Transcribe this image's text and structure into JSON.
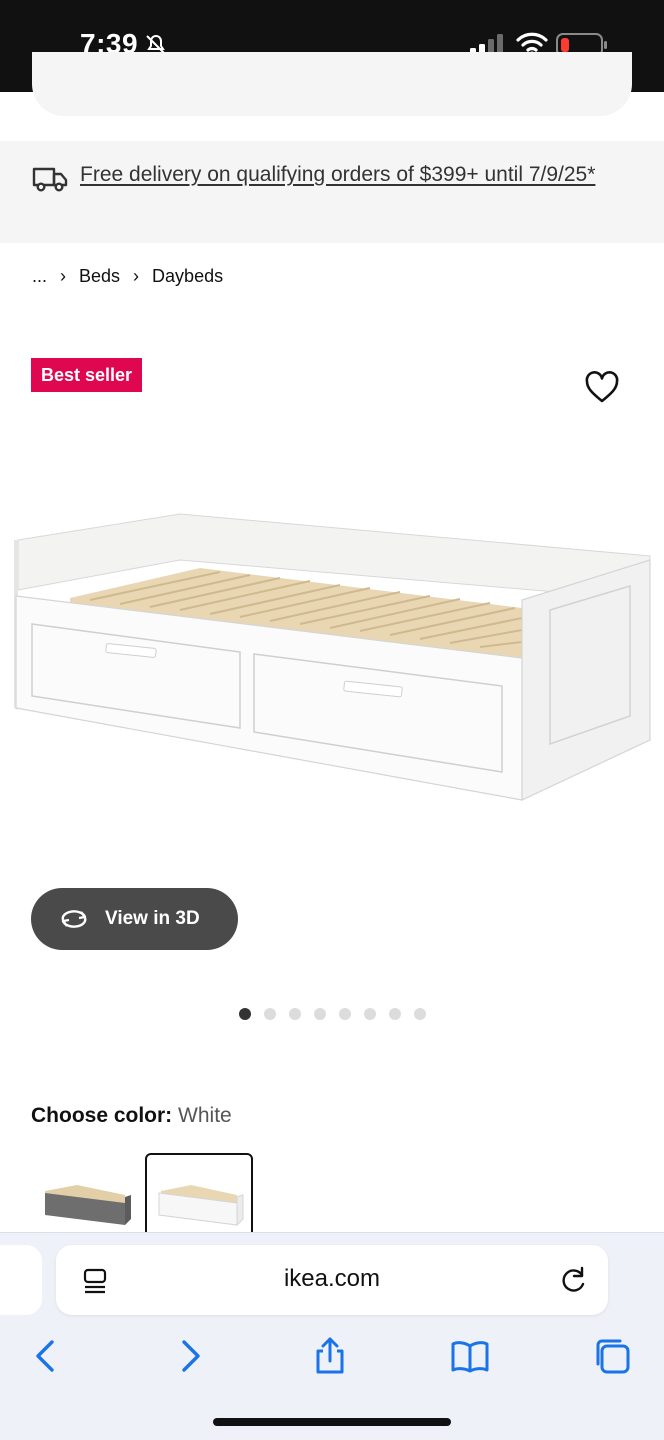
{
  "status_bar": {
    "time": "7:39",
    "icons": [
      "bell-slash-icon",
      "cellular-signal-icon",
      "wifi-icon",
      "battery-low-icon"
    ]
  },
  "delivery_banner": {
    "text": "Free delivery on qualifying orders of $399+ until 7/9/25*",
    "icon": "delivery-truck-icon"
  },
  "breadcrumb": {
    "ellipsis": "...",
    "items": [
      "Beds",
      "Daybeds"
    ]
  },
  "product": {
    "badge": "Best seller",
    "view3d_label": "View in 3D",
    "carousel": {
      "total": 8,
      "active_index": 0
    },
    "colors": {
      "color": {
        "brand_red": "#e00751"
      }
    }
  },
  "color_chooser": {
    "label": "Choose color:",
    "value": "White",
    "options": [
      "Grey",
      "White"
    ],
    "selected": "White"
  },
  "browser": {
    "url": "ikea.com"
  }
}
